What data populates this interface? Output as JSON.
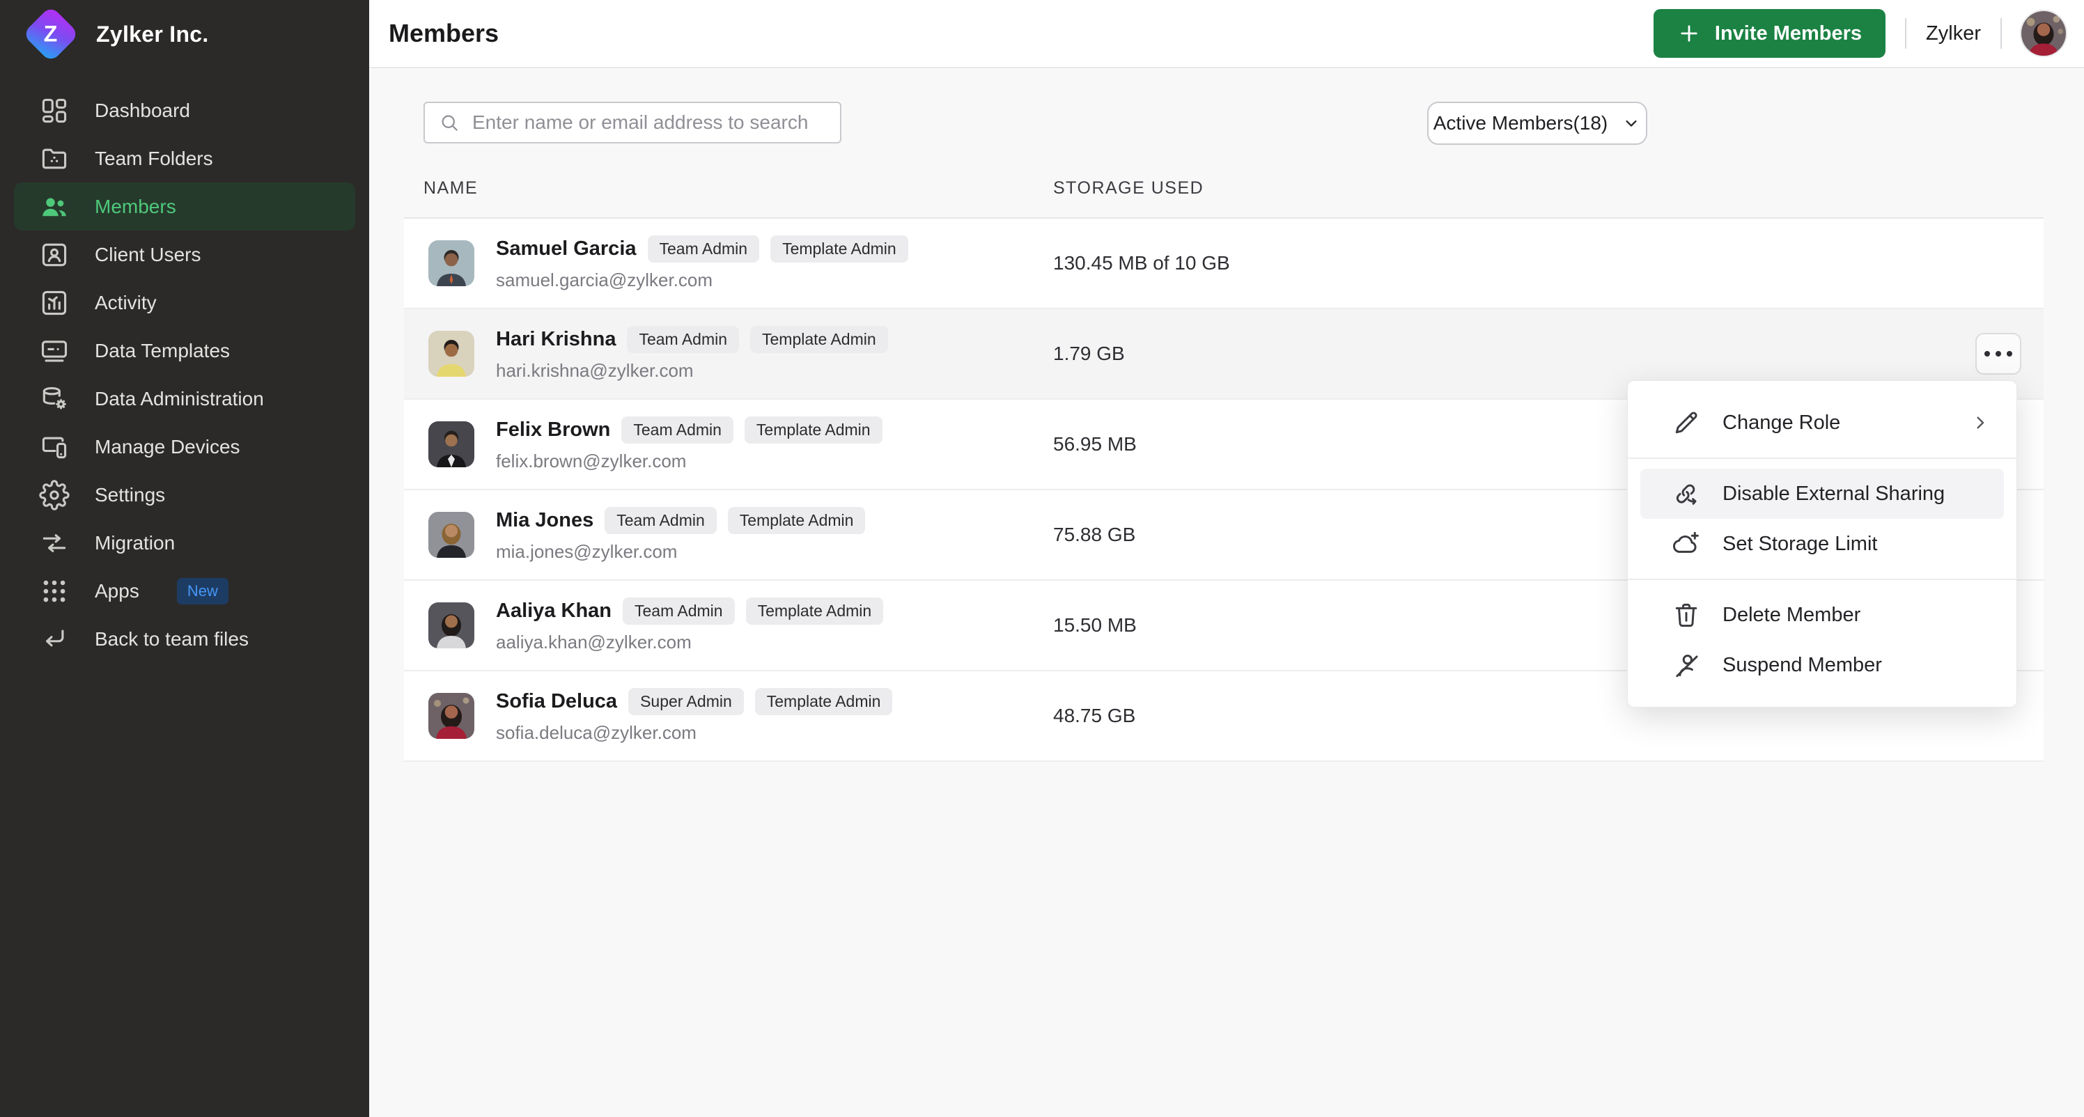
{
  "brand": {
    "company": "Zylker Inc.",
    "logo_letter": "Z"
  },
  "sidebar": {
    "items": [
      {
        "label": "Dashboard"
      },
      {
        "label": "Team Folders"
      },
      {
        "label": "Members",
        "active": true
      },
      {
        "label": "Client Users"
      },
      {
        "label": "Activity"
      },
      {
        "label": "Data Templates"
      },
      {
        "label": "Data Administration"
      },
      {
        "label": "Manage Devices"
      },
      {
        "label": "Settings"
      },
      {
        "label": "Migration"
      },
      {
        "label": "Apps",
        "badge": "New"
      },
      {
        "label": "Back to team files"
      }
    ]
  },
  "header": {
    "title": "Members",
    "invite_button": "Invite Members",
    "team_name": "Zylker"
  },
  "toolbar": {
    "search_placeholder": "Enter name or email address to search",
    "filter_label": "Active Members(18)"
  },
  "table": {
    "columns": [
      "NAME",
      "STORAGE USED"
    ]
  },
  "members": [
    {
      "name": "Samuel Garcia",
      "badges": [
        "Team Admin",
        "Template Admin"
      ],
      "email": "samuel.garcia@zylker.com",
      "storage": "130.45 MB of 10 GB"
    },
    {
      "name": "Hari Krishna",
      "badges": [
        "Team Admin",
        "Template Admin"
      ],
      "email": "hari.krishna@zylker.com",
      "storage": "1.79 GB"
    },
    {
      "name": "Felix Brown",
      "badges": [
        "Team Admin",
        "Template Admin"
      ],
      "email": "felix.brown@zylker.com",
      "storage": "56.95 MB"
    },
    {
      "name": "Mia Jones",
      "badges": [
        "Team Admin",
        "Template Admin"
      ],
      "email": "mia.jones@zylker.com",
      "storage": "75.88 GB"
    },
    {
      "name": "Aaliya Khan",
      "badges": [
        "Team Admin",
        "Template Admin"
      ],
      "email": "aaliya.khan@zylker.com",
      "storage": "15.50 MB"
    },
    {
      "name": "Sofia Deluca",
      "badges": [
        "Super Admin",
        "Template Admin"
      ],
      "email": "sofia.deluca@zylker.com",
      "storage": "48.75 GB"
    }
  ],
  "context_menu": {
    "items": [
      "Change Role",
      "Disable External Sharing",
      "Set Storage Limit",
      "Delete Member",
      "Suspend Member"
    ]
  },
  "colors": {
    "accent_green": "#1b8243",
    "sidebar_active_green": "#4ec97b",
    "new_badge_bg": "#1d3c63",
    "new_badge_text": "#4596f7"
  }
}
